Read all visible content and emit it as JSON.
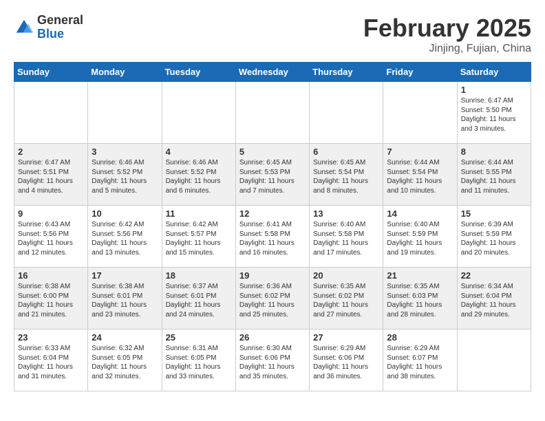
{
  "logo": {
    "general": "General",
    "blue": "Blue"
  },
  "title": "February 2025",
  "subtitle": "Jinjing, Fujian, China",
  "days": [
    "Sunday",
    "Monday",
    "Tuesday",
    "Wednesday",
    "Thursday",
    "Friday",
    "Saturday"
  ],
  "weeks": [
    [
      {
        "day": "",
        "info": ""
      },
      {
        "day": "",
        "info": ""
      },
      {
        "day": "",
        "info": ""
      },
      {
        "day": "",
        "info": ""
      },
      {
        "day": "",
        "info": ""
      },
      {
        "day": "",
        "info": ""
      },
      {
        "day": "1",
        "info": "Sunrise: 6:47 AM\nSunset: 5:50 PM\nDaylight: 11 hours\nand 3 minutes."
      }
    ],
    [
      {
        "day": "2",
        "info": "Sunrise: 6:47 AM\nSunset: 5:51 PM\nDaylight: 11 hours\nand 4 minutes."
      },
      {
        "day": "3",
        "info": "Sunrise: 6:46 AM\nSunset: 5:52 PM\nDaylight: 11 hours\nand 5 minutes."
      },
      {
        "day": "4",
        "info": "Sunrise: 6:46 AM\nSunset: 5:52 PM\nDaylight: 11 hours\nand 6 minutes."
      },
      {
        "day": "5",
        "info": "Sunrise: 6:45 AM\nSunset: 5:53 PM\nDaylight: 11 hours\nand 7 minutes."
      },
      {
        "day": "6",
        "info": "Sunrise: 6:45 AM\nSunset: 5:54 PM\nDaylight: 11 hours\nand 8 minutes."
      },
      {
        "day": "7",
        "info": "Sunrise: 6:44 AM\nSunset: 5:54 PM\nDaylight: 11 hours\nand 10 minutes."
      },
      {
        "day": "8",
        "info": "Sunrise: 6:44 AM\nSunset: 5:55 PM\nDaylight: 11 hours\nand 11 minutes."
      }
    ],
    [
      {
        "day": "9",
        "info": "Sunrise: 6:43 AM\nSunset: 5:56 PM\nDaylight: 11 hours\nand 12 minutes."
      },
      {
        "day": "10",
        "info": "Sunrise: 6:42 AM\nSunset: 5:56 PM\nDaylight: 11 hours\nand 13 minutes."
      },
      {
        "day": "11",
        "info": "Sunrise: 6:42 AM\nSunset: 5:57 PM\nDaylight: 11 hours\nand 15 minutes."
      },
      {
        "day": "12",
        "info": "Sunrise: 6:41 AM\nSunset: 5:58 PM\nDaylight: 11 hours\nand 16 minutes."
      },
      {
        "day": "13",
        "info": "Sunrise: 6:40 AM\nSunset: 5:58 PM\nDaylight: 11 hours\nand 17 minutes."
      },
      {
        "day": "14",
        "info": "Sunrise: 6:40 AM\nSunset: 5:59 PM\nDaylight: 11 hours\nand 19 minutes."
      },
      {
        "day": "15",
        "info": "Sunrise: 6:39 AM\nSunset: 5:59 PM\nDaylight: 11 hours\nand 20 minutes."
      }
    ],
    [
      {
        "day": "16",
        "info": "Sunrise: 6:38 AM\nSunset: 6:00 PM\nDaylight: 11 hours\nand 21 minutes."
      },
      {
        "day": "17",
        "info": "Sunrise: 6:38 AM\nSunset: 6:01 PM\nDaylight: 11 hours\nand 23 minutes."
      },
      {
        "day": "18",
        "info": "Sunrise: 6:37 AM\nSunset: 6:01 PM\nDaylight: 11 hours\nand 24 minutes."
      },
      {
        "day": "19",
        "info": "Sunrise: 6:36 AM\nSunset: 6:02 PM\nDaylight: 11 hours\nand 25 minutes."
      },
      {
        "day": "20",
        "info": "Sunrise: 6:35 AM\nSunset: 6:02 PM\nDaylight: 11 hours\nand 27 minutes."
      },
      {
        "day": "21",
        "info": "Sunrise: 6:35 AM\nSunset: 6:03 PM\nDaylight: 11 hours\nand 28 minutes."
      },
      {
        "day": "22",
        "info": "Sunrise: 6:34 AM\nSunset: 6:04 PM\nDaylight: 11 hours\nand 29 minutes."
      }
    ],
    [
      {
        "day": "23",
        "info": "Sunrise: 6:33 AM\nSunset: 6:04 PM\nDaylight: 11 hours\nand 31 minutes."
      },
      {
        "day": "24",
        "info": "Sunrise: 6:32 AM\nSunset: 6:05 PM\nDaylight: 11 hours\nand 32 minutes."
      },
      {
        "day": "25",
        "info": "Sunrise: 6:31 AM\nSunset: 6:05 PM\nDaylight: 11 hours\nand 33 minutes."
      },
      {
        "day": "26",
        "info": "Sunrise: 6:30 AM\nSunset: 6:06 PM\nDaylight: 11 hours\nand 35 minutes."
      },
      {
        "day": "27",
        "info": "Sunrise: 6:29 AM\nSunset: 6:06 PM\nDaylight: 11 hours\nand 36 minutes."
      },
      {
        "day": "28",
        "info": "Sunrise: 6:29 AM\nSunset: 6:07 PM\nDaylight: 11 hours\nand 38 minutes."
      },
      {
        "day": "",
        "info": ""
      }
    ]
  ]
}
